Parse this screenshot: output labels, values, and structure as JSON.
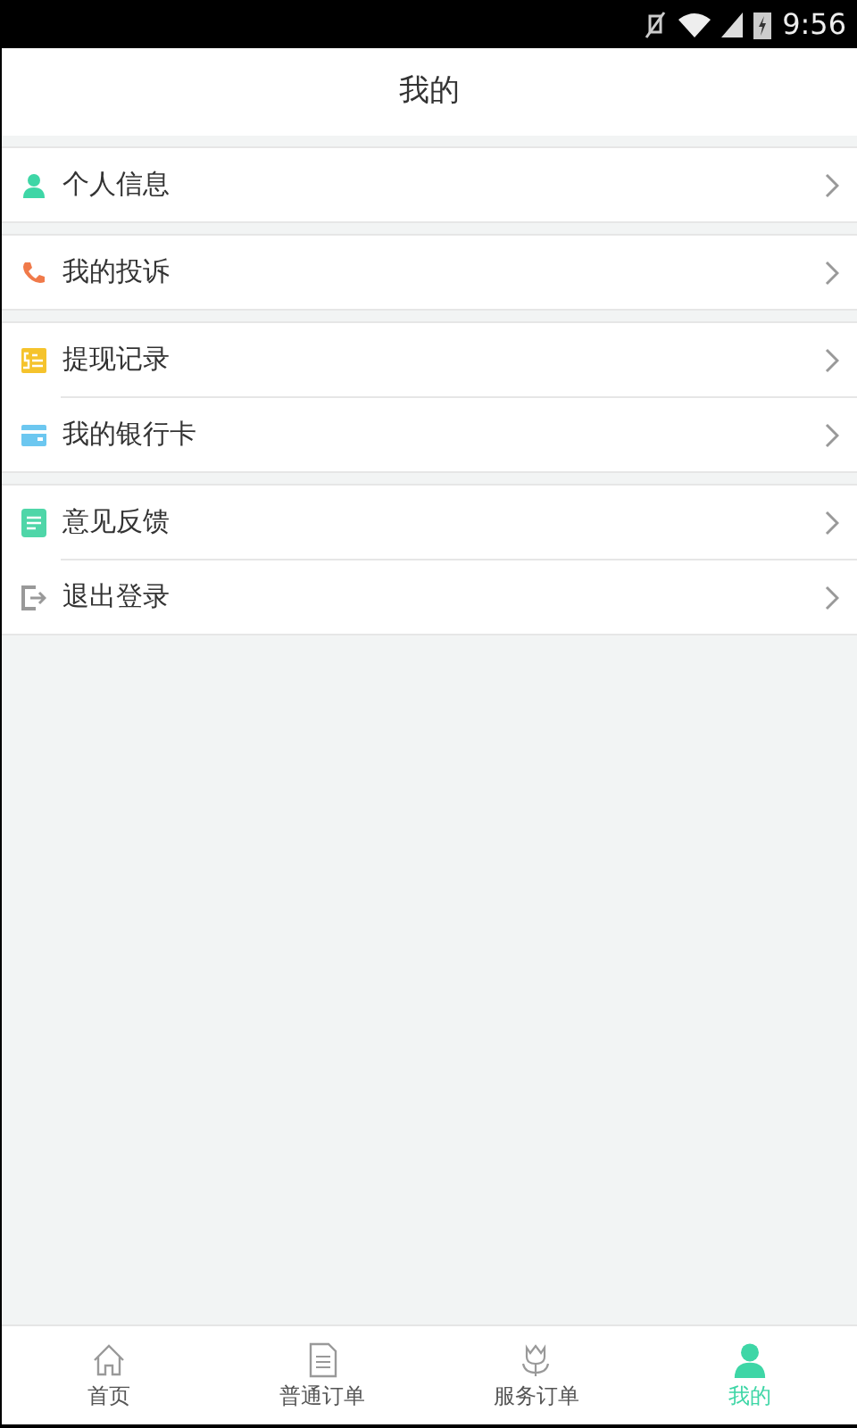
{
  "status_bar": {
    "time": "9:56"
  },
  "header": {
    "title": "我的"
  },
  "groups": [
    {
      "items": [
        {
          "kind": "person",
          "label": "个人信息"
        }
      ]
    },
    {
      "items": [
        {
          "kind": "phone",
          "label": "我的投诉"
        }
      ]
    },
    {
      "items": [
        {
          "kind": "cash",
          "label": "提现记录"
        },
        {
          "kind": "card",
          "label": "我的银行卡"
        }
      ]
    },
    {
      "items": [
        {
          "kind": "note",
          "label": "意见反馈"
        },
        {
          "kind": "logout",
          "label": "退出登录"
        }
      ]
    }
  ],
  "tab_bar": [
    {
      "kind": "home",
      "label": "首页",
      "selected": false
    },
    {
      "kind": "doc",
      "label": "普通订单",
      "selected": false
    },
    {
      "kind": "flower",
      "label": "服务订单",
      "selected": false
    },
    {
      "kind": "person",
      "label": "我的",
      "selected": true
    }
  ]
}
